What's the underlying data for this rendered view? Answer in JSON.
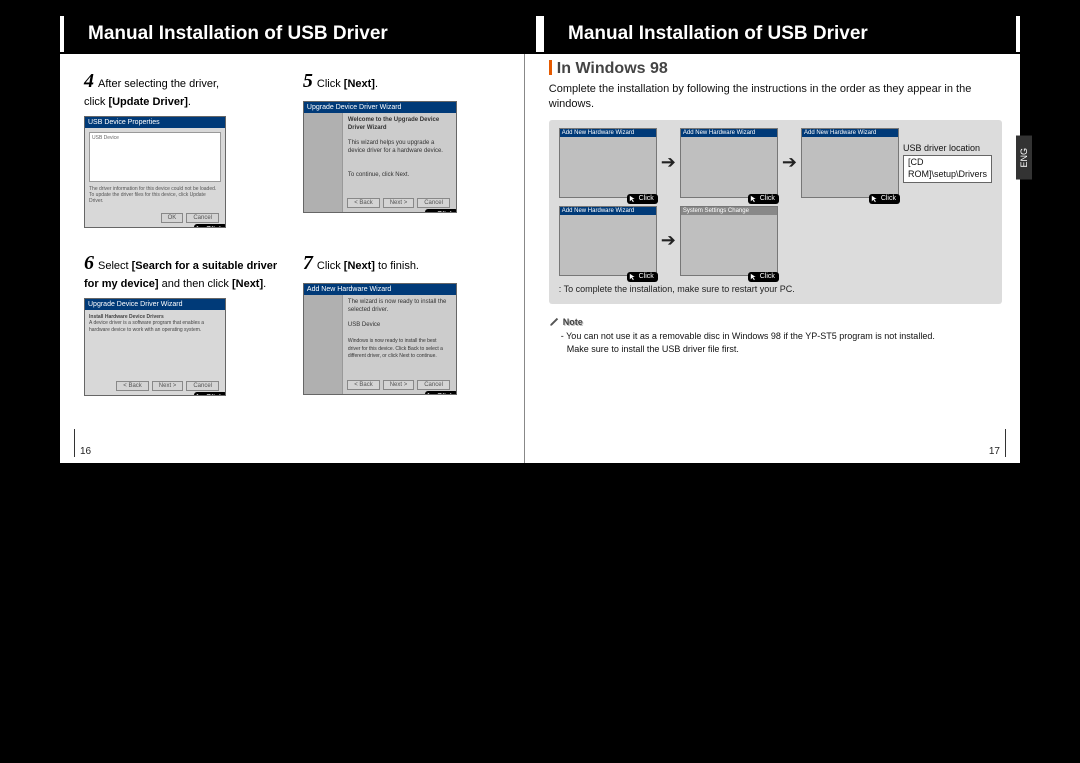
{
  "title_left": "Manual Installation of USB Driver",
  "title_right": "Manual Installation of USB Driver",
  "eng_tab": "ENG",
  "steps": {
    "s4": {
      "num": "4",
      "text_a": "After selecting the driver,",
      "text_b": "click ",
      "bold_b": "[Update Driver]",
      "tail_b": "."
    },
    "s5": {
      "num": "5",
      "text_a": "Click ",
      "bold_a": "[Next]",
      "tail_a": "."
    },
    "s6": {
      "num": "6",
      "text_a": "Select  ",
      "bold_a": "[Search for a suitable driver for my device]",
      "tail_a": " and then click ",
      "bold_b": "[Next]",
      "tail_b": "."
    },
    "s7": {
      "num": "7",
      "text_a": "Click ",
      "bold_a": "[Next]",
      "tail_a": " to finish."
    }
  },
  "screenshots": {
    "ss4_title": "USB Device Properties",
    "ss5_title": "Upgrade Device Driver Wizard",
    "ss5_head": "Welcome to the Upgrade Device Driver Wizard",
    "ss5_body": "This wizard helps you upgrade a device driver for a hardware device.",
    "ss5_cont": "To continue, click Next.",
    "ss6_title": "Upgrade Device Driver Wizard",
    "ss7_title": "Add New Hardware Wizard",
    "ss7_body1": "The wizard is now ready to install the selected driver.",
    "ss7_body2": "USB Device",
    "btn_ok": "OK",
    "btn_cancel": "Cancel",
    "btn_back": "< Back",
    "btn_next": "Next >",
    "click": "Click"
  },
  "right_page": {
    "section_title": "In Windows 98",
    "intro": "Complete the installation by following the instructions in the order as they appear in the windows.",
    "mini_title": "Add New Hardware Wizard",
    "driver_loc_label": "USB driver location",
    "driver_loc_path": "[CD ROM]\\setup\\Drivers",
    "footer": ": To complete the installation, make sure to restart your PC."
  },
  "note": {
    "label": "Note",
    "line1": "- You can not use it as a removable disc in Windows 98 if the YP-ST5 program is not installed.",
    "line2": "Make sure to install the USB driver file first."
  },
  "page_numbers": {
    "left": "16",
    "right": "17"
  }
}
